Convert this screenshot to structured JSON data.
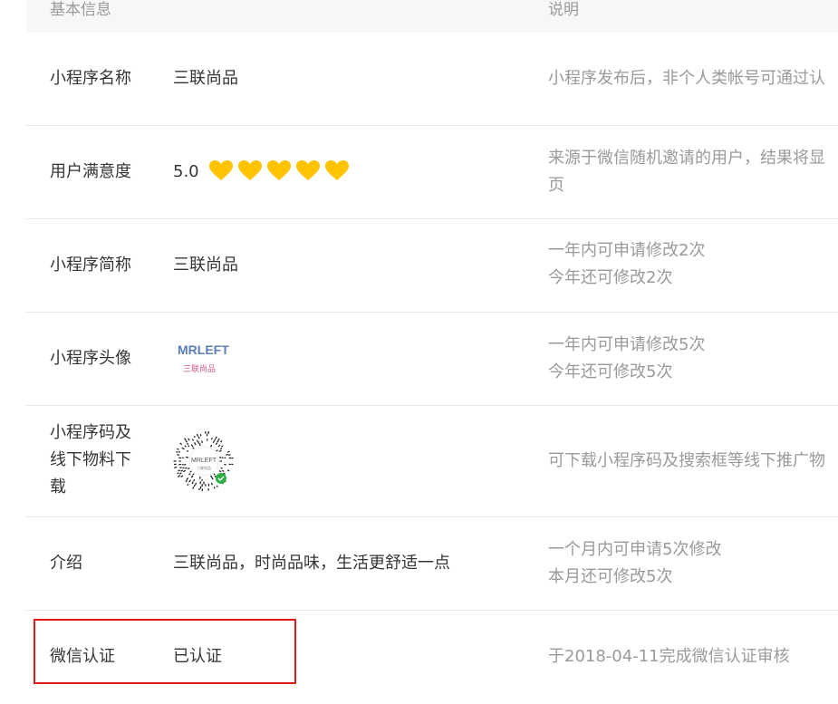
{
  "header": {
    "basic_info": "基本信息",
    "description": "说明"
  },
  "rows": [
    {
      "label": "小程序名称",
      "value": "三联尚品",
      "desc_lines": [
        "小程序发布后，非个人类帐号可通过认"
      ]
    },
    {
      "label": "用户满意度",
      "value": "5.0",
      "rating": 5,
      "rating_max": 5,
      "rating_icon": "heart-icon",
      "rating_color": "#ffc300",
      "desc_lines": [
        "来源于微信随机邀请的用户，结果将显",
        "页"
      ]
    },
    {
      "label": "小程序简称",
      "value": "三联尚品",
      "desc_lines": [
        "一年内可申请修改2次",
        "今年还可修改2次"
      ]
    },
    {
      "label": "小程序头像",
      "avatar": {
        "logo_text": "MRLEFT",
        "logo_sub": "三联尚品"
      },
      "desc_lines": [
        "一年内可申请修改5次",
        "今年还可修改5次"
      ]
    },
    {
      "label_lines": [
        "小程序码及",
        "线下物料下",
        "载"
      ],
      "qr": {
        "logo_text": "MRLEFT",
        "logo_sub": "三联尚品"
      },
      "desc_lines": [
        "可下载小程序码及搜索框等线下推广物"
      ]
    },
    {
      "label": "介绍",
      "value": "三联尚品，时尚品味，生活更舒适一点",
      "desc_lines": [
        "一个月内可申请5次修改",
        "本月还可修改5次"
      ]
    },
    {
      "label": "微信认证",
      "value": "已认证",
      "desc_lines": [
        "于2018-04-11完成微信认证审核"
      ]
    }
  ],
  "colors": {
    "highlight_border": "#e0191b",
    "header_bg": "#f6f7f9",
    "desc_text": "#9a9a9a",
    "row_divider": "#e7e7eb"
  }
}
